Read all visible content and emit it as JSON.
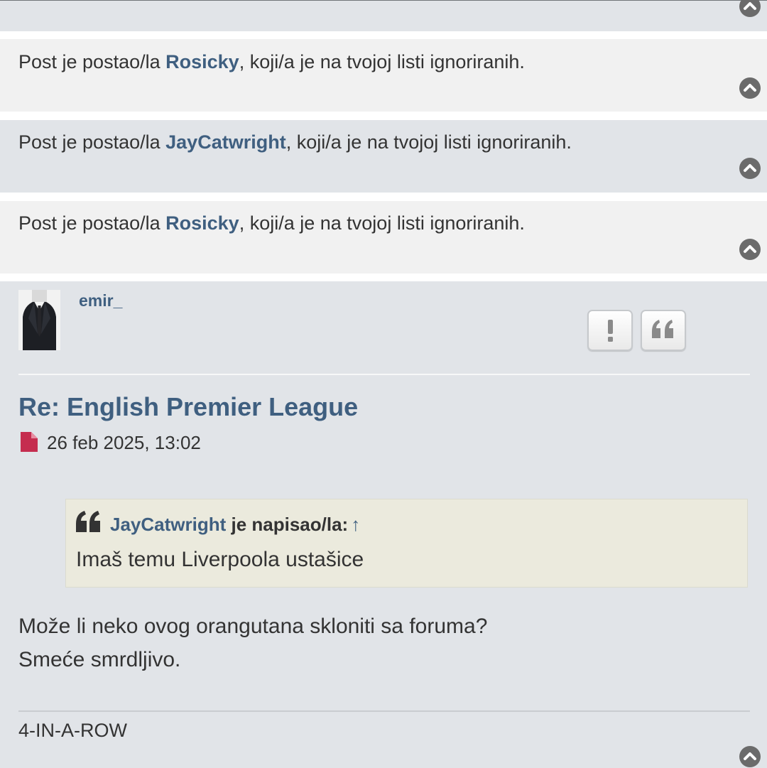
{
  "ignored_posts": [
    {
      "prefix": "Post je postao/la ",
      "username": "Rosicky",
      "suffix": ", koji/a je na tvojoj listi ignoriranih."
    },
    {
      "prefix": "Post je postao/la ",
      "username": "JayCatwright",
      "suffix": ", koji/a je na tvojoj listi ignoriranih."
    },
    {
      "prefix": "Post je postao/la ",
      "username": "Rosicky",
      "suffix": ", koji/a je na tvojoj listi ignoriranih."
    }
  ],
  "post": {
    "author": "emir_",
    "title": "Re: English Premier League",
    "date": "26 feb 2025, 13:02",
    "quote": {
      "username": "JayCatwright",
      "wrote": " je napisao/la:",
      "up_arrow": "↑",
      "text": "Imaš temu Liverpoola ustašice"
    },
    "body_lines": [
      "Može li neko ovog orangutana skloniti sa foruma?",
      "Smeće smrdljivo."
    ],
    "signature": "4-IN-A-ROW"
  },
  "icons": {
    "top": "chevron-up-circle-icon",
    "report": "exclamation-icon",
    "quote": "quote-icon",
    "post": "file-icon"
  },
  "colors": {
    "username": "#3f5f80",
    "bg_light": "#f1f1f1",
    "bg_dark": "#e1e4e8",
    "quote_bg": "#ebeadd",
    "post_icon": "#c52d4f"
  }
}
